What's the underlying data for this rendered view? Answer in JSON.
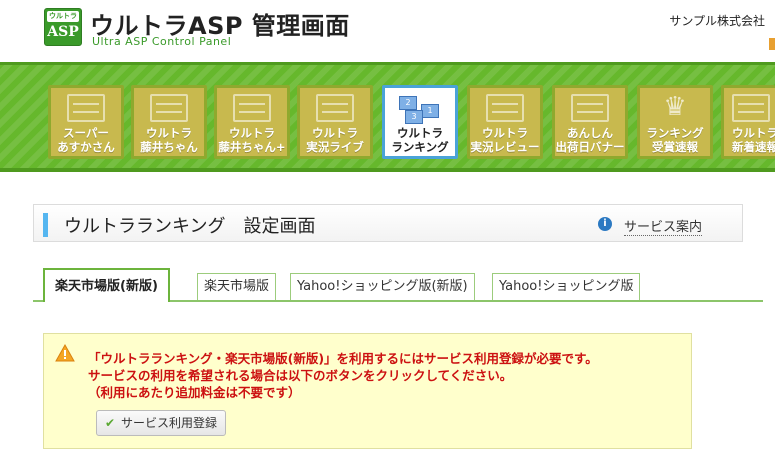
{
  "header": {
    "logo_tag": "ウルトラ",
    "logo_text": "ASP",
    "title": "ウルトラASP 管理画面",
    "subtitle": "Ultra ASP Control Panel",
    "company": "サンプル株式会社"
  },
  "services": [
    {
      "id": "super-asukasan",
      "line1": "スーパー",
      "line2": "あすかさん",
      "active": false
    },
    {
      "id": "ultra-fujiichan",
      "line1": "ウルトラ",
      "line2": "藤井ちゃん",
      "active": false
    },
    {
      "id": "ultra-fujiichan-plus",
      "line1": "ウルトラ",
      "line2": "藤井ちゃん+",
      "active": false
    },
    {
      "id": "ultra-live",
      "line1": "ウルトラ",
      "line2": "実況ライブ",
      "active": false
    },
    {
      "id": "ultra-ranking",
      "line1": "ウルトラ",
      "line2": "ランキング",
      "active": true
    },
    {
      "id": "ultra-review",
      "line1": "ウルトラ",
      "line2": "実況レビュー",
      "active": false
    },
    {
      "id": "anshin-banner",
      "line1": "あんしん",
      "line2": "出荷日バナー",
      "active": false
    },
    {
      "id": "ranking-award",
      "line1": "ランキング",
      "line2": "受賞速報",
      "active": false
    },
    {
      "id": "ultra-new-arrivals",
      "line1": "ウルトラ",
      "line2": "新着速報",
      "active": false
    }
  ],
  "page": {
    "title": "ウルトラランキング　設定画面",
    "service_info_label": "サービス案内"
  },
  "tabs": [
    {
      "label": "楽天市場版(新版)",
      "active": true
    },
    {
      "label": "楽天市場版",
      "active": false
    },
    {
      "label": "Yahoo!ショッピング版(新版)",
      "active": false
    },
    {
      "label": "Yahoo!ショッピング版",
      "active": false
    }
  ],
  "notice": {
    "line1": "「ウルトラランキング・楽天市場版(新版)」を利用するにはサービス利用登録が必要です。",
    "line2": "サービスの利用を希望される場合は以下のボタンをクリックしてください。",
    "line3": "（利用にあたり追加料金は不要です）",
    "button_label": "サービス利用登録"
  },
  "colors": {
    "brand_green": "#66b82c",
    "active_tile_border": "#4aa3d8",
    "warning_text": "#cc1111",
    "notice_bg": "#ffffcc"
  }
}
